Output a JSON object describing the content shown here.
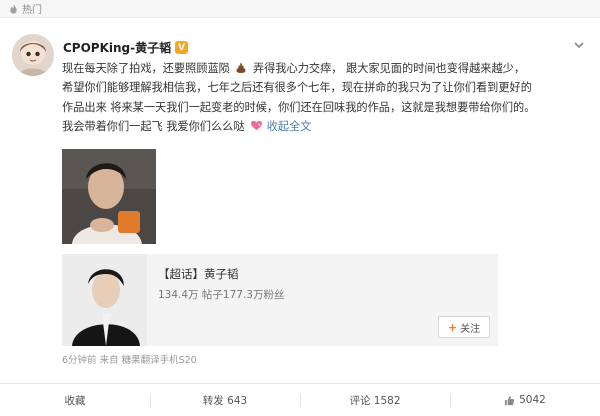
{
  "header": {
    "hot_label": "热门"
  },
  "post": {
    "author": "CPOPKing-黄子韬",
    "vip_badge": "V",
    "lines": [
      {
        "a": "现在每天除了拍戏，还要照顾蓝陨",
        "b": "弄得我心力交瘁，  跟大家见面的时间也变得越来越少，"
      },
      {
        "a": "希望你们能够理解我相信我，七年之后还有很多个七年，现在拼命的我只为了让你们看到更好的"
      },
      {
        "a": "作品出来 将来某一天我们一起变老的时候，你们还在回味我的作品，这就是我想要带给你们的。"
      },
      {
        "a": "我会带着你们一起飞 我爱你们么么哒",
        "expand": "收起全文"
      }
    ],
    "topic": {
      "title": "【超话】黄子韬",
      "stats": "134.4万 帖子177.3万粉丝",
      "follow_label": "关注"
    },
    "meta": "6分钟前 来自 糖果翻译手机S20"
  },
  "actions": {
    "favorite": "收藏",
    "repost": "转发 643",
    "comment": "评论 1582",
    "like": "5042"
  },
  "icons": [
    "fire-icon",
    "chevron-down-icon",
    "poop-emoji-icon",
    "heart-emoji-icon",
    "like-icon"
  ],
  "colors": {
    "link": "#507daf",
    "vip": "#f5a623",
    "follow_plus": "#f57b2c"
  }
}
